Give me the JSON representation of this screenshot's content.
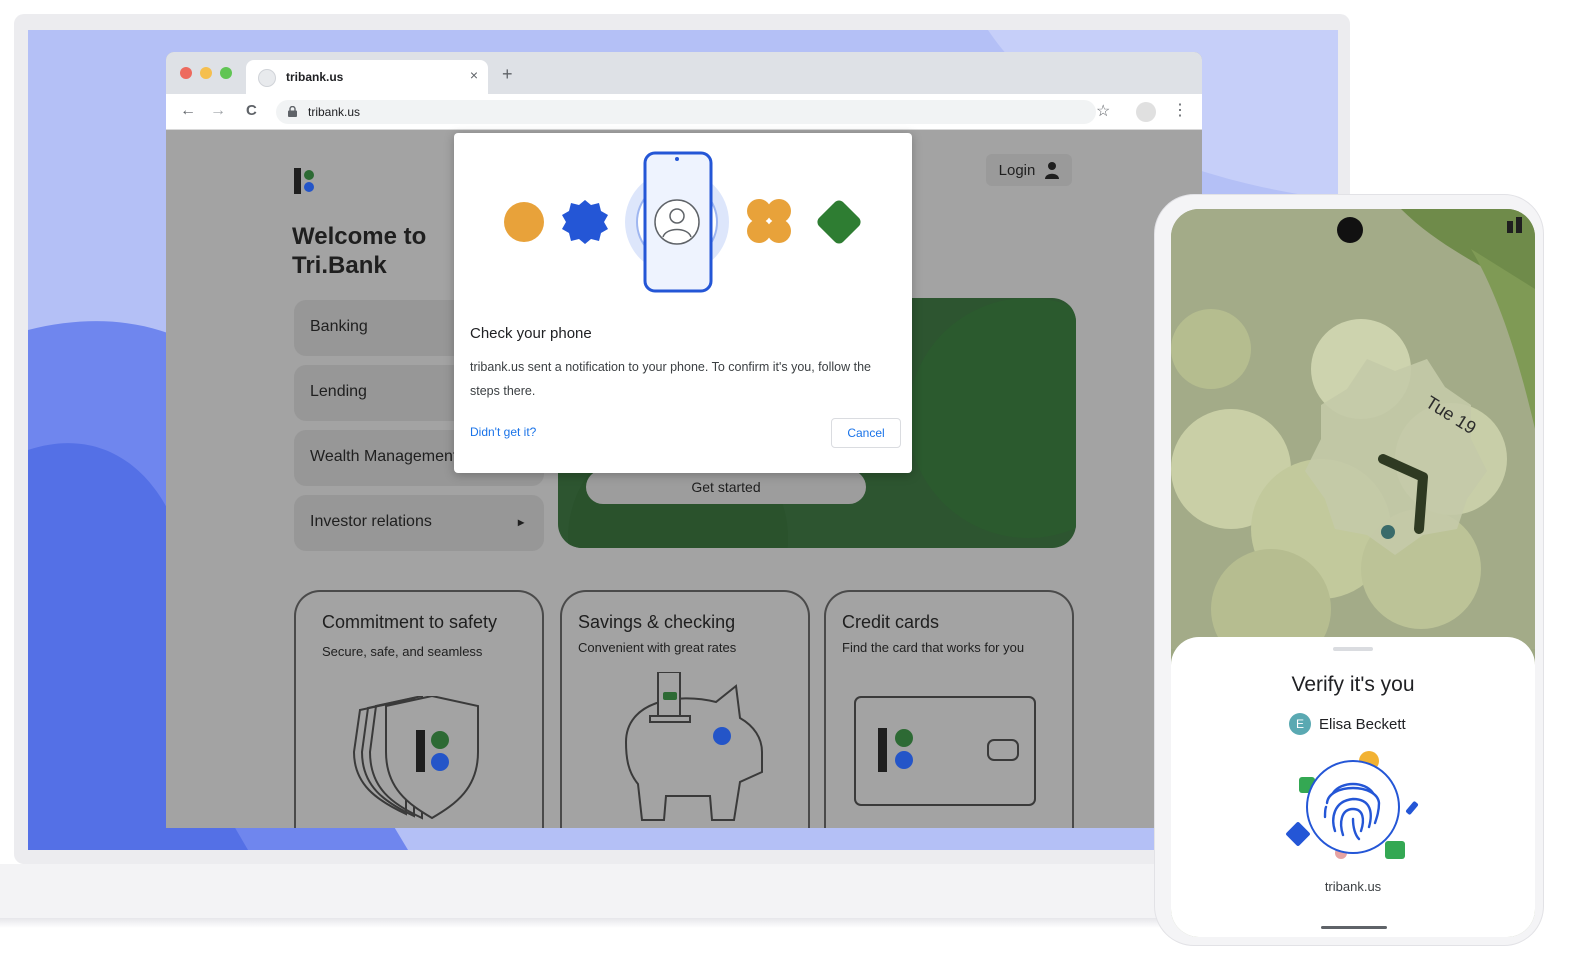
{
  "browser": {
    "tab_title": "tribank.us",
    "tab_close": "×",
    "new_tab": "+",
    "url": "tribank.us",
    "back": "←",
    "forward": "→",
    "reload": "C",
    "star": "☆",
    "menu": "⋮",
    "traffic_lights": [
      "#ed6a5e",
      "#f5bf4f",
      "#61c554"
    ]
  },
  "page": {
    "welcome": "Welcome to Tri.Bank",
    "login_label": "Login",
    "sidebar": [
      {
        "label": "Banking"
      },
      {
        "label": "Lending"
      },
      {
        "label": "Wealth Management"
      },
      {
        "label": "Investor relations",
        "arrow": "▸"
      }
    ],
    "hero_button": "Get started",
    "cards": [
      {
        "title": "Commitment to safety",
        "subtitle": "Secure, safe, and seamless"
      },
      {
        "title": "Savings & checking",
        "subtitle": "Convenient with great rates"
      },
      {
        "title": "Credit cards",
        "subtitle": "Find the card that works for you"
      }
    ]
  },
  "dialog": {
    "title": "Check your phone",
    "body": "tribank.us sent a notification to your phone. To confirm it's you, follow the steps there.",
    "help_link": "Didn't get it?",
    "cancel": "Cancel"
  },
  "phone": {
    "date": "Tue 19",
    "sheet_title": "Verify it's you",
    "avatar_initial": "E",
    "account_name": "Elisa Beckett",
    "site": "tribank.us"
  },
  "colors": {
    "accent_blue": "#1a73e8",
    "brand_green": "#2d5530",
    "shape_orange": "#e8a23a",
    "shape_blue": "#2456d6",
    "shape_green": "#2e7d32"
  }
}
